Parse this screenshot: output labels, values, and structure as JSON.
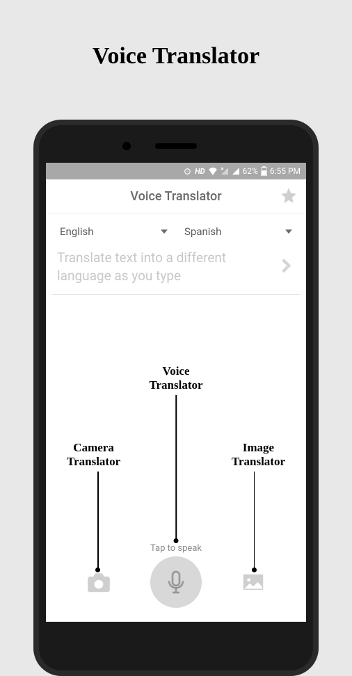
{
  "page": {
    "title": "Voice Translator"
  },
  "statusbar": {
    "hd": "HD",
    "battery_pct": "62%",
    "time": "6:55 PM"
  },
  "header": {
    "title": "Voice Translator"
  },
  "languages": {
    "from": "English",
    "to": "Spanish"
  },
  "input": {
    "placeholder": "Translate text into a different language as you type"
  },
  "annotations": {
    "voice": "Voice\nTranslator",
    "camera": "Camera\nTranslator",
    "image": "Image\nTranslator"
  },
  "prompt": {
    "tap_to_speak": "Tap to speak"
  }
}
